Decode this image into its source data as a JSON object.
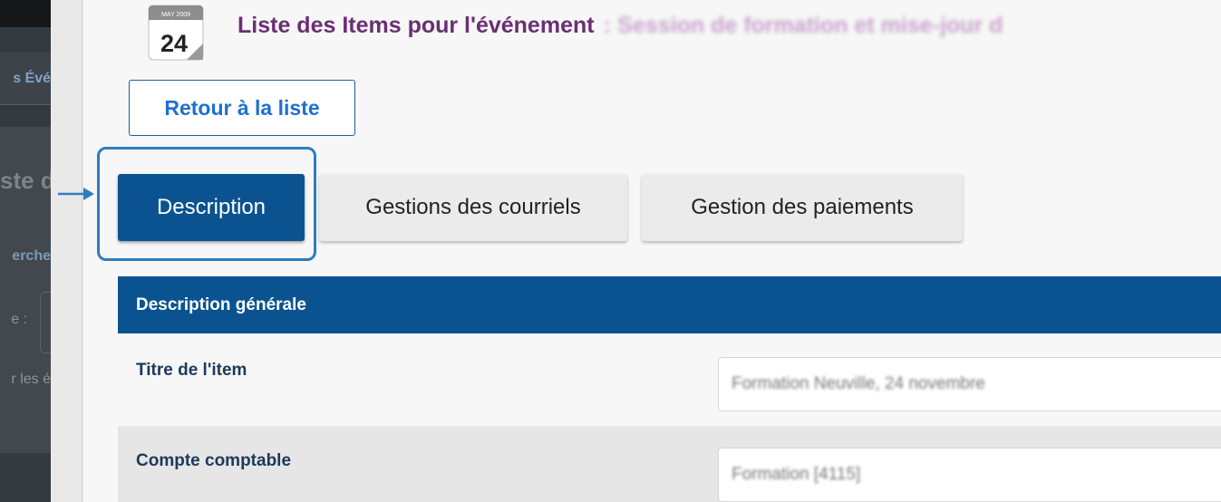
{
  "sidebar": {
    "nav_fragment": "s Évé",
    "heading_fragment": "ste d",
    "search_fragment": "erche",
    "field_label_fragment": "e :",
    "link_fragment": "r les é"
  },
  "calendar_icon": {
    "month": "MAY 2009",
    "day": "24"
  },
  "header": {
    "title": "Liste des Items pour l'événement",
    "event_name": ": Session de formation et mise-jour d"
  },
  "back_button": {
    "label": "Retour à la liste"
  },
  "tabs": [
    {
      "label": "Description",
      "active": true
    },
    {
      "label": "Gestions des courriels",
      "active": false
    },
    {
      "label": "Gestion des paiements",
      "active": false
    }
  ],
  "section": {
    "title": "Description générale",
    "fields": [
      {
        "label": "Titre de l'item",
        "value": "Formation Neuville, 24 novembre"
      },
      {
        "label": "Compte comptable",
        "value": "Formation [4115]"
      }
    ]
  },
  "colors": {
    "primary": "#0b5390",
    "title": "#6a2f73",
    "link": "#1f6fd0",
    "highlight": "#2d7dc0"
  }
}
